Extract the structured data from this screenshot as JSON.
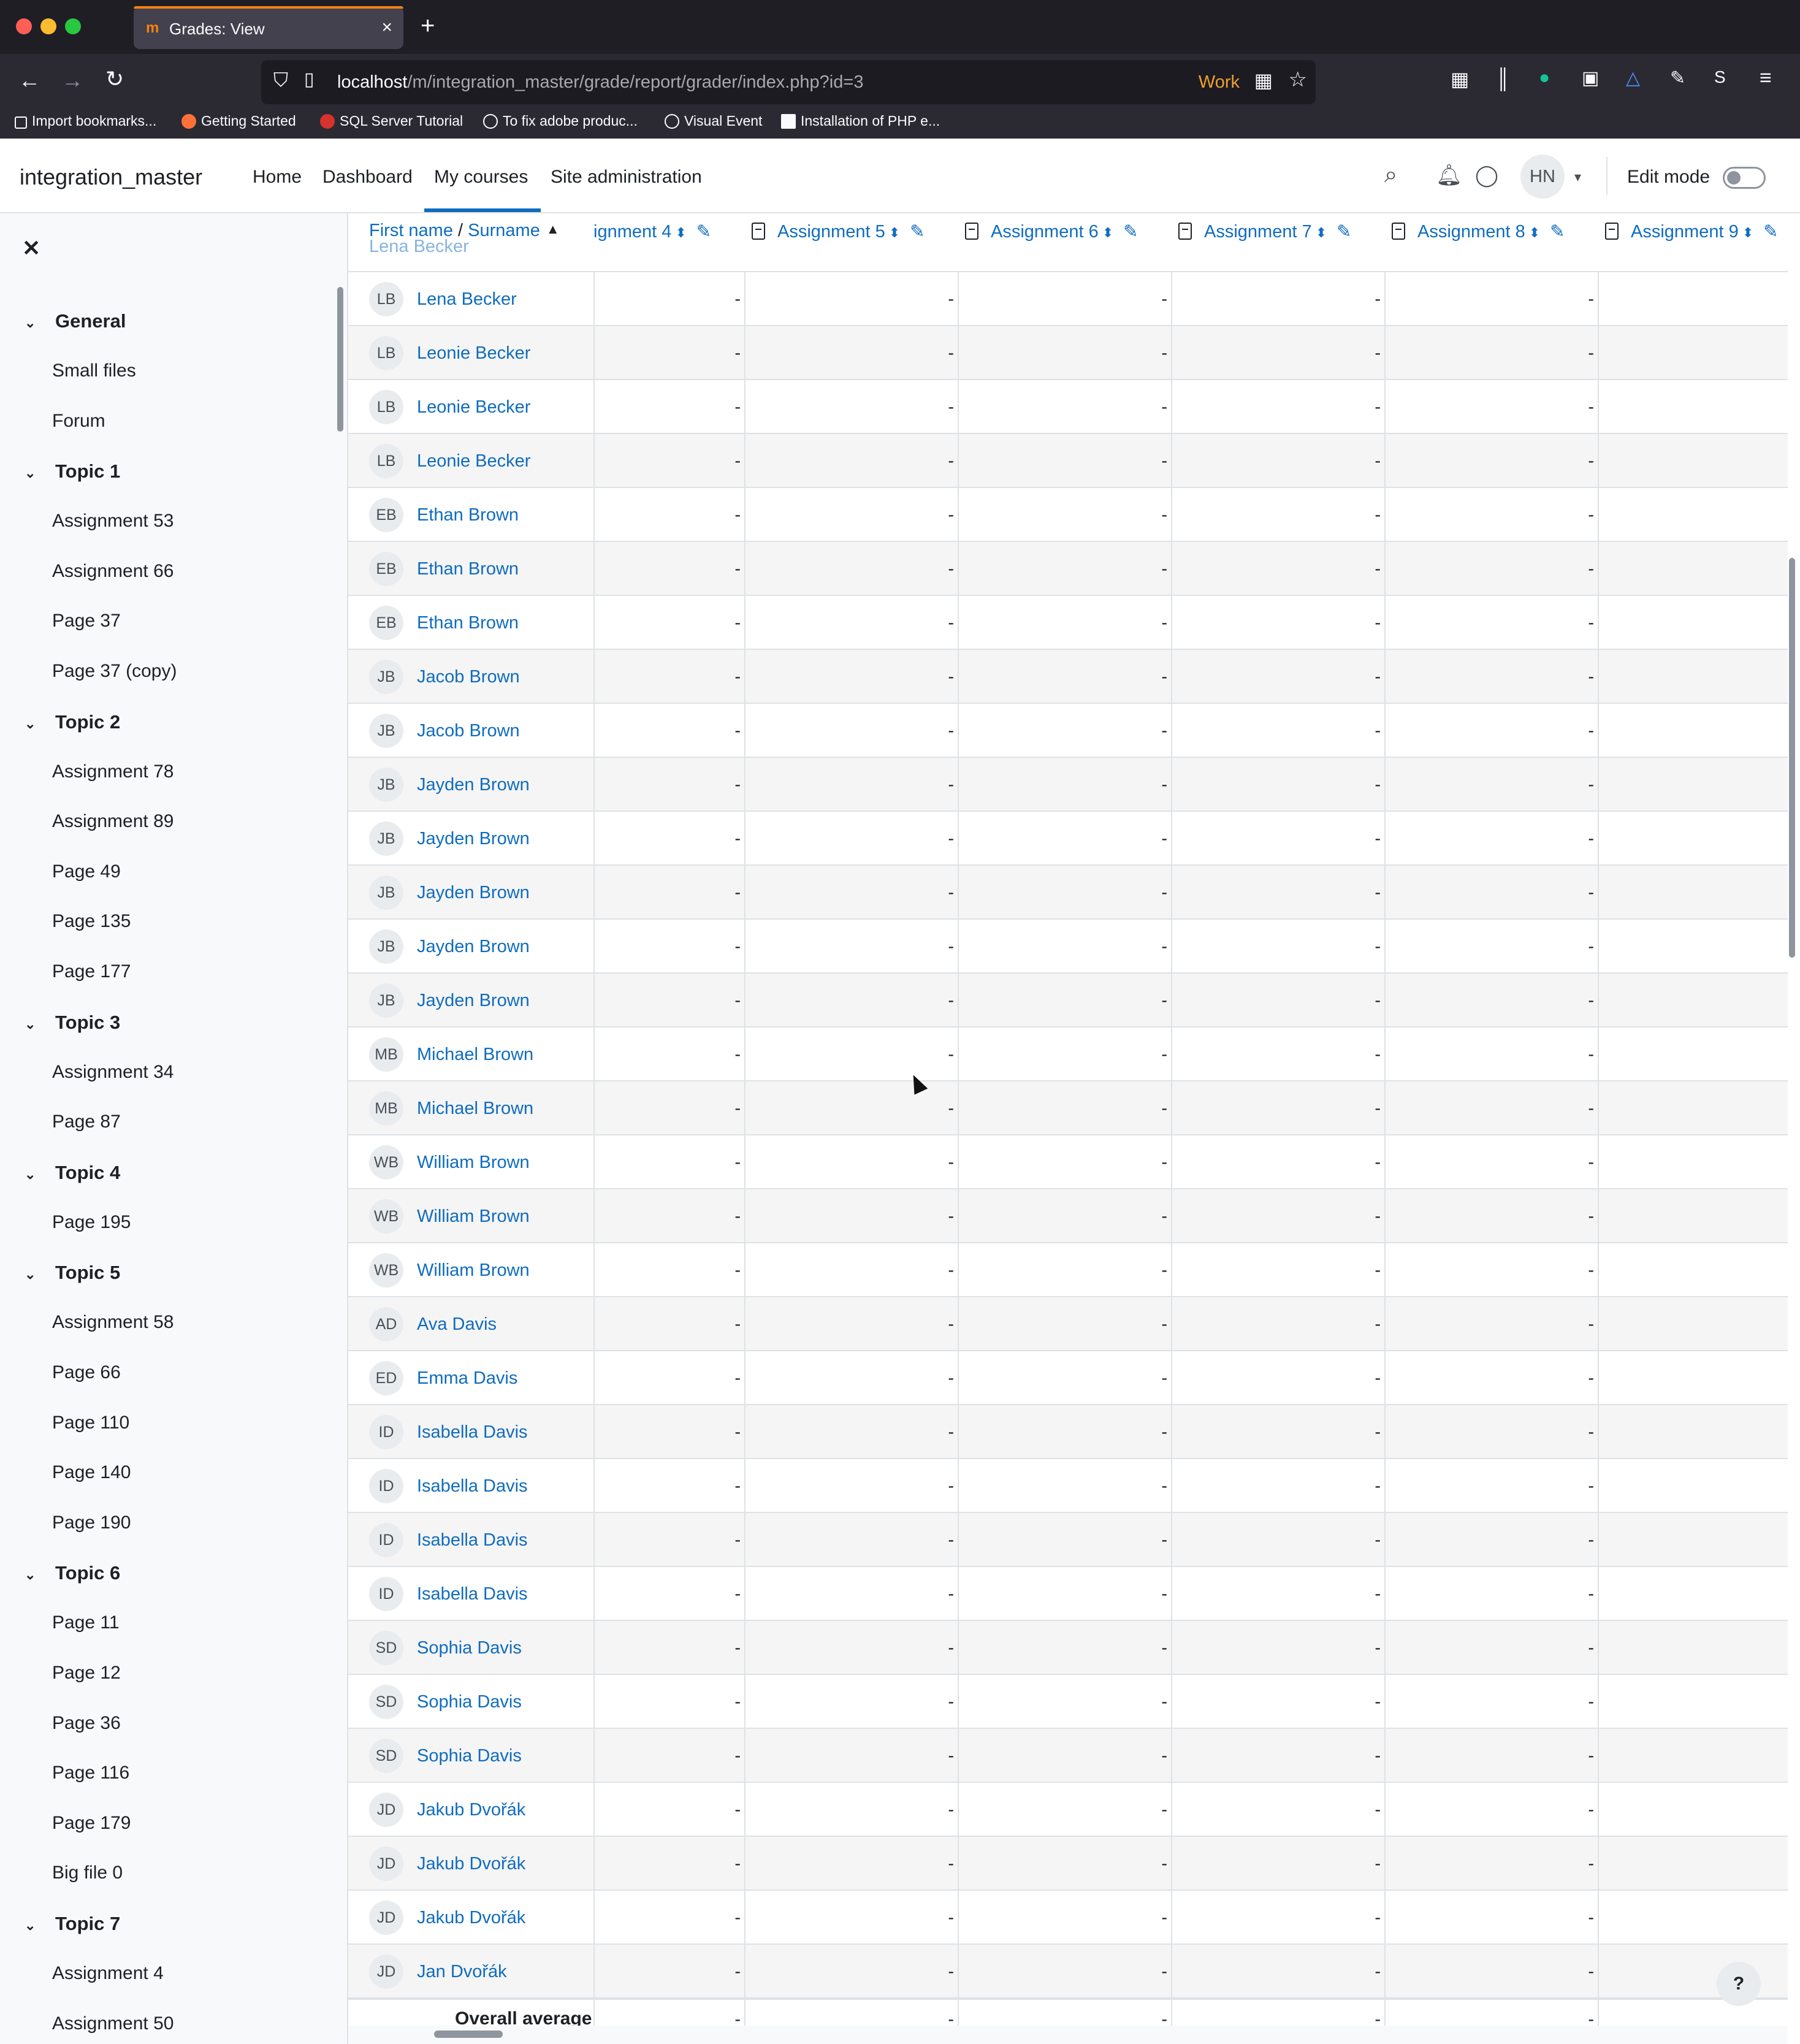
{
  "browser": {
    "tab_title": "Grades: View",
    "url_host": "localhost",
    "url_path": "/m/integration_master/grade/report/grader/index.php?id=3",
    "container_label": "Work",
    "bookmarks": [
      "Import bookmarks...",
      "Getting Started",
      "SQL Server Tutorial",
      "To fix adobe produc...",
      "Visual Event",
      "Installation of PHP e..."
    ]
  },
  "header": {
    "site_name": "integration_master",
    "nav": [
      "Home",
      "Dashboard",
      "My courses",
      "Site administration"
    ],
    "active_nav": "My courses",
    "user_initials": "HN",
    "edit_mode_label": "Edit mode"
  },
  "course_index": [
    {
      "section": "General",
      "items": [
        "Small files",
        "Forum"
      ]
    },
    {
      "section": "Topic 1",
      "items": [
        "Assignment 53",
        "Assignment 66",
        "Page 37",
        "Page 37 (copy)"
      ]
    },
    {
      "section": "Topic 2",
      "items": [
        "Assignment 78",
        "Assignment 89",
        "Page 49",
        "Page 135",
        "Page 177"
      ]
    },
    {
      "section": "Topic 3",
      "items": [
        "Assignment 34",
        "Page 87"
      ]
    },
    {
      "section": "Topic 4",
      "items": [
        "Page 195"
      ]
    },
    {
      "section": "Topic 5",
      "items": [
        "Assignment 58",
        "Page 66",
        "Page 110",
        "Page 140",
        "Page 190"
      ]
    },
    {
      "section": "Topic 6",
      "items": [
        "Page 11",
        "Page 12",
        "Page 36",
        "Page 116",
        "Page 179",
        "Big file 0"
      ]
    },
    {
      "section": "Topic 7",
      "items": [
        "Assignment 4",
        "Assignment 50"
      ]
    }
  ],
  "grader": {
    "name_header": {
      "first": "First name",
      "separator": "/",
      "last": "Surname"
    },
    "partial_top_student": "Lena Becker",
    "columns": [
      "ignment 4",
      "Assignment 5",
      "Assignment 6",
      "Assignment 7",
      "Assignment 8",
      "Assignment 9"
    ],
    "empty_value": "-",
    "rows": [
      {
        "initials": "LB",
        "name": "Lena Becker"
      },
      {
        "initials": "LB",
        "name": "Leonie Becker"
      },
      {
        "initials": "LB",
        "name": "Leonie Becker"
      },
      {
        "initials": "LB",
        "name": "Leonie Becker"
      },
      {
        "initials": "EB",
        "name": "Ethan Brown"
      },
      {
        "initials": "EB",
        "name": "Ethan Brown"
      },
      {
        "initials": "EB",
        "name": "Ethan Brown"
      },
      {
        "initials": "JB",
        "name": "Jacob Brown"
      },
      {
        "initials": "JB",
        "name": "Jacob Brown"
      },
      {
        "initials": "JB",
        "name": "Jayden Brown"
      },
      {
        "initials": "JB",
        "name": "Jayden Brown"
      },
      {
        "initials": "JB",
        "name": "Jayden Brown"
      },
      {
        "initials": "JB",
        "name": "Jayden Brown"
      },
      {
        "initials": "JB",
        "name": "Jayden Brown"
      },
      {
        "initials": "MB",
        "name": "Michael Brown"
      },
      {
        "initials": "MB",
        "name": "Michael Brown"
      },
      {
        "initials": "WB",
        "name": "William Brown"
      },
      {
        "initials": "WB",
        "name": "William Brown"
      },
      {
        "initials": "WB",
        "name": "William Brown"
      },
      {
        "initials": "AD",
        "name": "Ava Davis"
      },
      {
        "initials": "ED",
        "name": "Emma Davis"
      },
      {
        "initials": "ID",
        "name": "Isabella Davis"
      },
      {
        "initials": "ID",
        "name": "Isabella Davis"
      },
      {
        "initials": "ID",
        "name": "Isabella Davis"
      },
      {
        "initials": "ID",
        "name": "Isabella Davis"
      },
      {
        "initials": "SD",
        "name": "Sophia Davis"
      },
      {
        "initials": "SD",
        "name": "Sophia Davis"
      },
      {
        "initials": "SD",
        "name": "Sophia Davis"
      },
      {
        "initials": "JD",
        "name": "Jakub Dvořák"
      },
      {
        "initials": "JD",
        "name": "Jakub Dvořák"
      },
      {
        "initials": "JD",
        "name": "Jakub Dvořák"
      },
      {
        "initials": "JD",
        "name": "Jan Dvořák"
      }
    ],
    "overall_average_label": "Overall average"
  },
  "help_label": "?"
}
